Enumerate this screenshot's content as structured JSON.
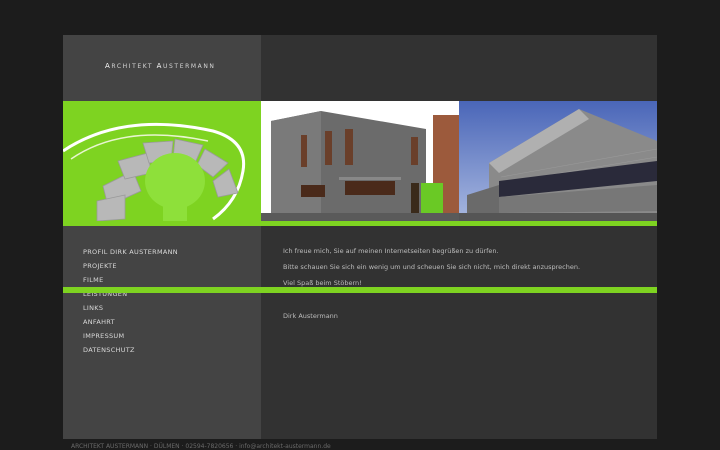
{
  "header": {
    "logo_first_cap": "A",
    "logo_first_rest": "RCHITEKT",
    "logo_second_cap": "A",
    "logo_second_rest": "USTERMANN"
  },
  "nav": {
    "items": [
      "PROFIL DIRK AUSTERMANN",
      "PROJEKTE",
      "FILME",
      "LEISTUNGEN",
      "LINKS",
      "ANFAHRT",
      "IMPRESSUM",
      "DATENSCHUTZ"
    ]
  },
  "content": {
    "line1": "Ich freue mich, Sie auf meinen Internetseiten begrüßen zu dürfen.",
    "line2": "Bitte schauen Sie sich ein wenig um und scheuen Sie sich nicht, mich direkt anzusprechen.",
    "line3": "Viel Spaß beim Stöbern!",
    "signature": "Dirk Austermann"
  },
  "footer": {
    "text": "ARCHITEKT AUSTERMANN · DÜLMEN · 02594-7820656 · info@architekt-austermann.de"
  },
  "colors": {
    "background": "#1c1c1c",
    "page": "#323232",
    "sidebar": "#444444",
    "accent_green": "#7ed321"
  }
}
